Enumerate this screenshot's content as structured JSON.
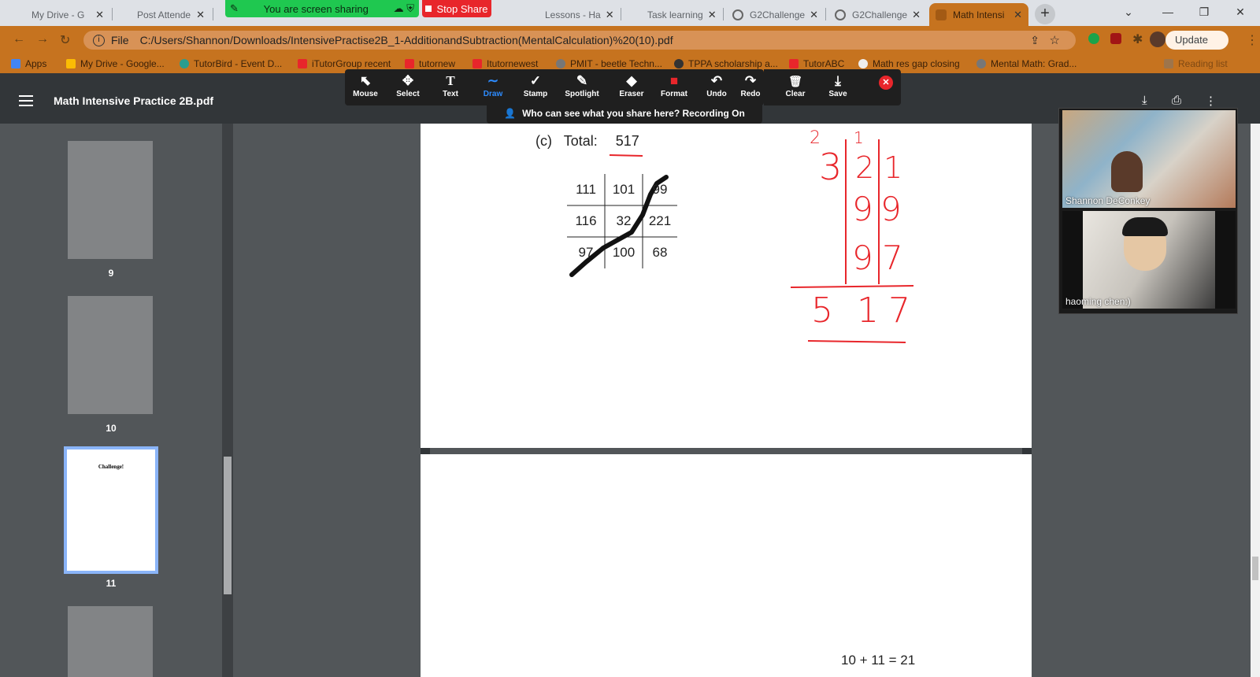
{
  "tabs": [
    {
      "title": "My Drive - G",
      "color": "#fbbc04"
    },
    {
      "title": "Post Attende",
      "color": "#2d8cff"
    },
    {
      "title": "",
      "color": "#0f9d58"
    },
    {
      "title": "",
      "color": "#4285f4"
    },
    {
      "title": "",
      "color": "#888888"
    },
    {
      "title": "Lessons - Ha",
      "color": "#eeeeee"
    },
    {
      "title": "Task learning",
      "color": "#eeeeee"
    },
    {
      "title": "G2Challenge",
      "color": "#888888"
    },
    {
      "title": "G2Challenge",
      "color": "#888888"
    },
    {
      "title": "Math Intensi",
      "color": "#c6731f"
    }
  ],
  "share": {
    "status": "You are screen sharing",
    "stop": "Stop Share"
  },
  "omnibox": {
    "scheme": "File",
    "url": "C:/Users/Shannon/Downloads/IntensivePractise2B_1-AdditionandSubtraction(MentalCalculation)%20(10).pdf",
    "update": "Update"
  },
  "bookmarks": [
    {
      "label": "Apps",
      "color": "#4285f4"
    },
    {
      "label": "My Drive - Google...",
      "color": "#fbbc04"
    },
    {
      "label": "TutorBird - Event D...",
      "color": "#2a9d8f"
    },
    {
      "label": "iTutorGroup recent",
      "color": "#e8262b"
    },
    {
      "label": "tutornew",
      "color": "#e8262b"
    },
    {
      "label": "Itutornewest",
      "color": "#e8262b"
    },
    {
      "label": "PMIT - beetle Techn...",
      "color": "#777777"
    },
    {
      "label": "TPPA scholarship a...",
      "color": "#333333"
    },
    {
      "label": "TutorABC",
      "color": "#e8262b"
    },
    {
      "label": "Math res gap closing",
      "color": "#eeeeee"
    },
    {
      "label": "Mental Math: Grad...",
      "color": "#777777"
    },
    {
      "label": "Reading list",
      "color": "#777777"
    }
  ],
  "pdf": {
    "title": "Math Intensive Practice 2B.pdf"
  },
  "toolbar": [
    {
      "label": "Mouse",
      "glyph": "⬉"
    },
    {
      "label": "Select",
      "glyph": "✥"
    },
    {
      "label": "Text",
      "glyph": "T"
    },
    {
      "label": "Draw",
      "glyph": "∼"
    },
    {
      "label": "Stamp",
      "glyph": "✓"
    },
    {
      "label": "Spotlight",
      "glyph": "✎"
    },
    {
      "label": "Eraser",
      "glyph": "◆"
    },
    {
      "label": "Format",
      "glyph": "■"
    },
    {
      "label": "Undo",
      "glyph": "↶"
    },
    {
      "label": "Redo",
      "glyph": "↷"
    },
    {
      "label": "Clear",
      "glyph": "🗑"
    },
    {
      "label": "Save",
      "glyph": "⤓"
    }
  ],
  "recording": "Who can see what you share here? Recording On",
  "thumbs": [
    {
      "label": "9"
    },
    {
      "label": "10"
    },
    {
      "label": "11"
    },
    {
      "label": ""
    }
  ],
  "thumb_title": "Challenge!",
  "problem": {
    "part": "(c)",
    "total_label": "Total:",
    "total_value": "517",
    "grid": [
      [
        "111",
        "101",
        "99"
      ],
      [
        "116",
        "32",
        "221"
      ],
      [
        "97",
        "100",
        "68"
      ]
    ]
  },
  "handwritten": {
    "carries": [
      "2",
      "1"
    ],
    "columns": [
      [
        "3",
        "2",
        "1"
      ],
      [
        "",
        "9",
        "9"
      ],
      [
        "",
        "9",
        "7"
      ]
    ],
    "result": [
      "5",
      "1",
      "7"
    ]
  },
  "next_page_snippet": "10 + 11 = 21",
  "participants": [
    {
      "name": "Shannon DeConkey"
    },
    {
      "name": "haoming chen:)"
    }
  ]
}
